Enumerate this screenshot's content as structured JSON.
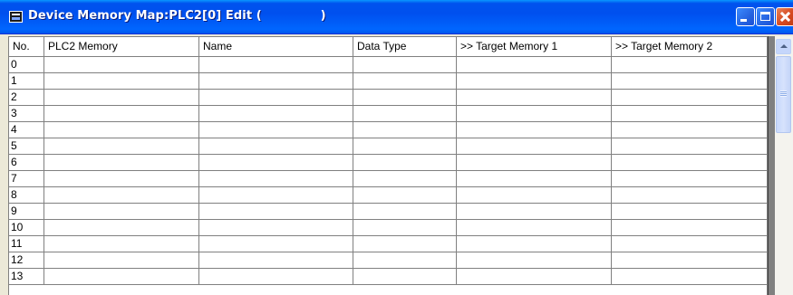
{
  "window": {
    "title": "Device Memory Map:PLC2[0] Edit (              )",
    "controls": {
      "minimize": "minimize",
      "maximize": "maximize",
      "close": "close"
    }
  },
  "grid": {
    "columns": [
      "No.",
      "PLC2 Memory",
      "Name",
      "Data Type",
      ">> Target Memory 1",
      ">> Target Memory 2"
    ],
    "rows": [
      {
        "no": "0",
        "plc2_memory": "",
        "name": "",
        "data_type": "",
        "target_memory_1": "",
        "target_memory_2": ""
      },
      {
        "no": "1",
        "plc2_memory": "",
        "name": "",
        "data_type": "",
        "target_memory_1": "",
        "target_memory_2": ""
      },
      {
        "no": "2",
        "plc2_memory": "",
        "name": "",
        "data_type": "",
        "target_memory_1": "",
        "target_memory_2": ""
      },
      {
        "no": "3",
        "plc2_memory": "",
        "name": "",
        "data_type": "",
        "target_memory_1": "",
        "target_memory_2": ""
      },
      {
        "no": "4",
        "plc2_memory": "",
        "name": "",
        "data_type": "",
        "target_memory_1": "",
        "target_memory_2": ""
      },
      {
        "no": "5",
        "plc2_memory": "",
        "name": "",
        "data_type": "",
        "target_memory_1": "",
        "target_memory_2": ""
      },
      {
        "no": "6",
        "plc2_memory": "",
        "name": "",
        "data_type": "",
        "target_memory_1": "",
        "target_memory_2": ""
      },
      {
        "no": "7",
        "plc2_memory": "",
        "name": "",
        "data_type": "",
        "target_memory_1": "",
        "target_memory_2": ""
      },
      {
        "no": "8",
        "plc2_memory": "",
        "name": "",
        "data_type": "",
        "target_memory_1": "",
        "target_memory_2": ""
      },
      {
        "no": "9",
        "plc2_memory": "",
        "name": "",
        "data_type": "",
        "target_memory_1": "",
        "target_memory_2": ""
      },
      {
        "no": "10",
        "plc2_memory": "",
        "name": "",
        "data_type": "",
        "target_memory_1": "",
        "target_memory_2": ""
      },
      {
        "no": "11",
        "plc2_memory": "",
        "name": "",
        "data_type": "",
        "target_memory_1": "",
        "target_memory_2": ""
      },
      {
        "no": "12",
        "plc2_memory": "",
        "name": "",
        "data_type": "",
        "target_memory_1": "",
        "target_memory_2": ""
      },
      {
        "no": "13",
        "plc2_memory": "",
        "name": "",
        "data_type": "",
        "target_memory_1": "",
        "target_memory_2": ""
      }
    ]
  },
  "colors": {
    "titlebar": "#0055ea",
    "window_bg": "#ece9d8",
    "grid_line": "#808080",
    "close_button": "#d64a22"
  }
}
